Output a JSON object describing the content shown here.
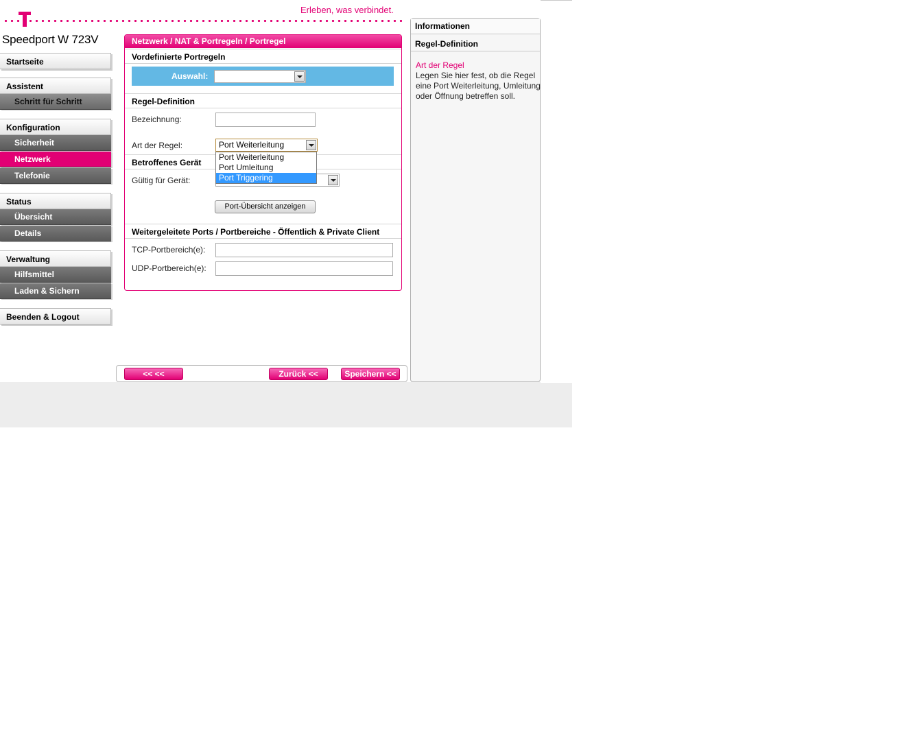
{
  "header": {
    "tagline": "Erleben, was verbindet.",
    "brand": "Speedport W 723V"
  },
  "sidebar": {
    "start": "Startseite",
    "assistent": "Assistent",
    "schritt": "Schritt für Schritt",
    "konfiguration": "Konfiguration",
    "sicherheit": "Sicherheit",
    "netzwerk": "Netzwerk",
    "telefonie": "Telefonie",
    "status": "Status",
    "uebersicht": "Übersicht",
    "details": "Details",
    "verwaltung": "Verwaltung",
    "hilfsmittel": "Hilfsmittel",
    "laden": "Laden & Sichern",
    "logout": "Beenden & Logout"
  },
  "main": {
    "title": "Netzwerk / NAT & Portregeln / Portregel",
    "predefined_heading": "Vordefinierte Portregeln",
    "auswahl_label": "Auswahl:",
    "auswahl_value": "",
    "regel_heading": "Regel-Definition",
    "bezeichnung_label": "Bezeichnung:",
    "bezeichnung_value": "",
    "art_label": "Art der Regel:",
    "art_value": "Port Weiterleitung",
    "art_options": [
      "Port Weiterleitung",
      "Port Umleitung",
      "Port Triggering"
    ],
    "geraet_heading": "Betroffenes Gerät",
    "geraet_label": "Gültig für Gerät:",
    "port_overview_button": "Port-Übersicht anzeigen",
    "ports_heading": "Weitergeleitete Ports / Portbereiche - Öffentlich & Private Client",
    "tcp_label": "TCP-Portbereich(e):",
    "udp_label": "UDP-Portbereich(e):"
  },
  "buttons": {
    "back_back": "<< <<",
    "zurueck": "Zurück <<",
    "speichern": "Speichern <<"
  },
  "info": {
    "title": "Informationen",
    "subtitle": "Regel-Definition",
    "heading": "Art der Regel",
    "text": "Legen Sie hier fest, ob die Regel eine Port Weiterleitung, Umleitung oder Öffnung betreffen soll."
  },
  "colors": {
    "magenta": "#e20074",
    "blue_bar": "#63b8e4",
    "highlight": "#3399ff"
  }
}
